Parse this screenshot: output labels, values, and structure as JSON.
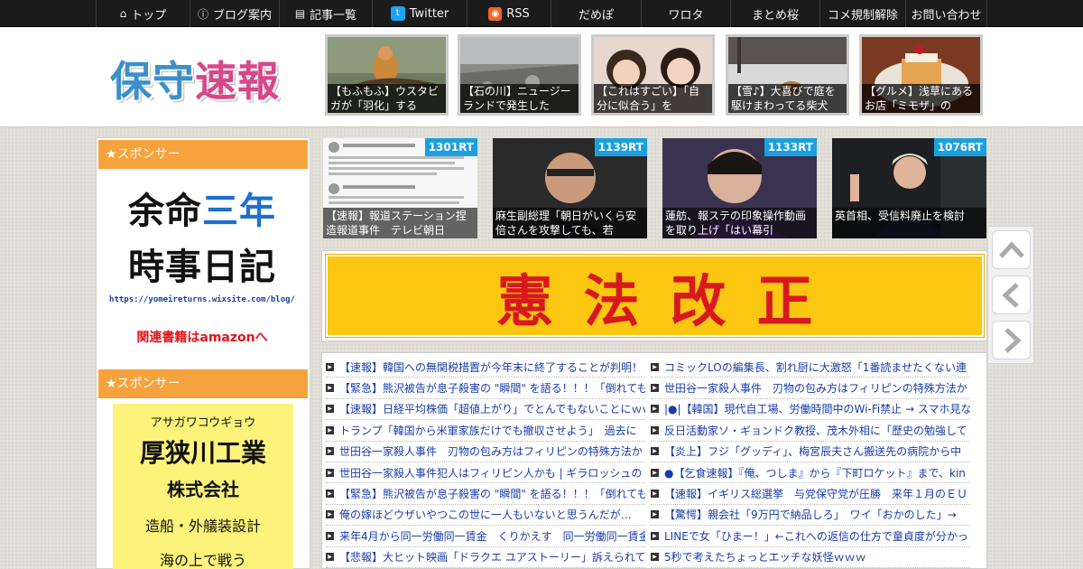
{
  "nav": {
    "items": [
      {
        "label": "トップ",
        "icon": "home-icon",
        "width": 104
      },
      {
        "label": "ブログ案内",
        "icon": "info-icon",
        "width": 99
      },
      {
        "label": "記事一覧",
        "icon": "list-icon",
        "width": 103
      },
      {
        "label": "Twitter",
        "icon": "twitter-icon",
        "width": 105
      },
      {
        "label": "RSS",
        "icon": "rss-icon",
        "width": 93
      },
      {
        "label": "だめぽ",
        "icon": "",
        "width": 100
      },
      {
        "label": "ワロタ",
        "icon": "",
        "width": 99
      },
      {
        "label": "まとめ桜",
        "icon": "",
        "width": 99
      },
      {
        "label": "コメ規制解除",
        "icon": "",
        "width": 95
      },
      {
        "label": "お問い合わせ",
        "icon": "",
        "width": 91
      }
    ]
  },
  "header": {
    "logo_part1": "保守",
    "logo_part2": "速報",
    "thumbs": [
      {
        "caption": "【もふもふ】ウスタビガが「羽化」する"
      },
      {
        "caption": "【石の川】ニュージーランドで発生した"
      },
      {
        "caption": "【これはすごい】「自分に似合う」を"
      },
      {
        "caption": "【雪♪】大喜びで庭を駆けまわってる柴犬"
      },
      {
        "caption": "【グルメ】浅草にあるお店「ミモザ」の"
      }
    ]
  },
  "sidebar": {
    "sponsor_label": "★スポンサー",
    "ad1": {
      "line1_a": "余命",
      "line1_b": "三年",
      "line2": "時事日記",
      "url": "https://yomeireturns.wixsite.com/blog/",
      "amazon": "関連書籍はamazonへ"
    },
    "ad2": {
      "kana": "アサガワコウギョウ",
      "name": "厚狭川工業",
      "company": "株式会社",
      "desc": "造船・外艤装設計",
      "extra": "海の上で戦う"
    }
  },
  "featured": [
    {
      "rt": "1301RT",
      "caption": "【速報】報道ステーション捏造報道事件　テレビ朝日"
    },
    {
      "rt": "1139RT",
      "caption": "麻生副総理「朝日がいくら安倍さんを攻撃しても、若"
    },
    {
      "rt": "1133RT",
      "caption": "蓮舫、報ステの印象操作動画を取り上げ「はい幕引"
    },
    {
      "rt": "1076RT",
      "caption": "英首相、受信料廃止を検討"
    }
  ],
  "banner": {
    "text": "憲法改正"
  },
  "news_left": [
    "【速報】韓国への無関税措置が今年末に終了することが判明！",
    "【緊急】熊沢被告が息子殺害の \"瞬間\" を語る！！！「倒れても",
    "【速報】日経平均株価「超値上がり」でとんでもないことにｗｗ",
    "トランプ「韓国から米軍家族だけでも撤収させよう」　過去に",
    "世田谷一家殺人事件　刃物の包み方はフィリピンの特殊方法か",
    "世田谷一家殺人事件犯人はフィリピン人かも | ギラロッシュの",
    "【緊急】熊沢被告が息子殺害の \"瞬間\" を語る！！！「倒れても",
    "俺の嫁ほどウザいやつこの世に一人もいないと思うんだが…",
    "来年4月から同一労働同一賃金　くりかえす　同一労働同一賃金",
    "【悲報】大ヒット映画「ドラクエ ユアストーリー」訴えられて"
  ],
  "news_right": [
    "コミックLOの編集長、割れ厨に大激怒「1番読ませたくない連",
    "世田谷一家殺人事件　刃物の包み方はフィリピンの特殊方法か",
    "|●|【韓国】現代自工場、労働時間中のWi-Fi禁止 → スマホ見な",
    "反日活動家ソ・ギョンドク教授、茂木外相に「歴史の勉強して",
    "【炎上】フジ「グッディ」、梅宮辰夫さん搬送先の病院から中",
    "●【乞食速報】『俺、つしま』から『下町ロケット』まで、kin",
    "【速報】イギリス総選挙　与党保守党が圧勝　来年１月のＥＵ",
    "【驚愕】親会社「9万円で納品しろ」　ワイ「おかのした」→",
    "LINEで女「ひまー！」←これへの返信の仕方で童貞度が分かっ",
    "5秒で考えたちょっとエッチな妖怪ｗｗｗ"
  ],
  "colors": {
    "nav_bg": "#1b1b1b",
    "sponsor_orange": "#f6a33e",
    "rt_badge": "#1aa0e0",
    "banner_yellow": "#fbc710",
    "banner_red": "#d8181f",
    "link_blue": "#1a3ca8"
  }
}
